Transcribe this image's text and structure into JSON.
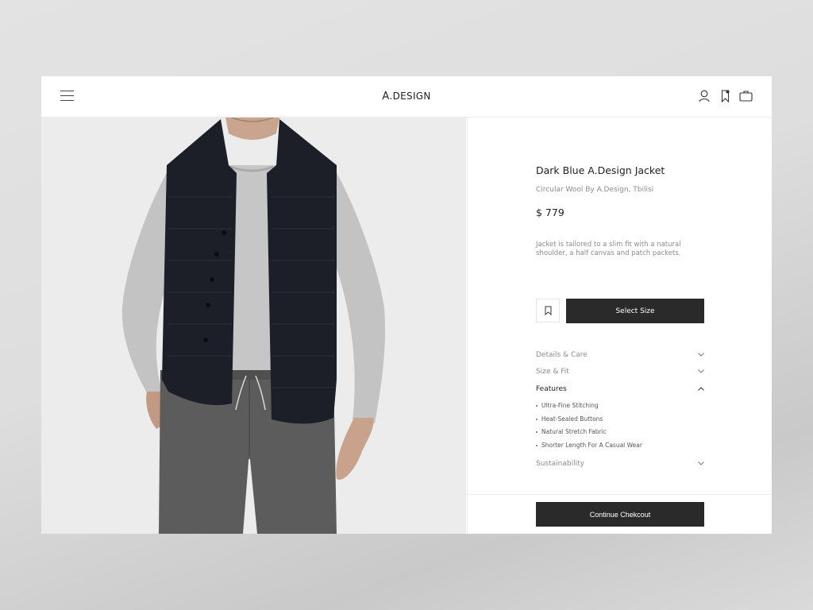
{
  "header": {
    "logo_mark": "A",
    "logo_text": ".DESIGN"
  },
  "product": {
    "title": "Dark Blue A.Design Jacket",
    "subtitle": "Circular Wool By A.Design, Tbilisi",
    "price": "$ 779",
    "description": "Jacket is tailored to a slim fit with a natural shoulder, a half canvas and patch packets.",
    "select_size_label": "Select Size"
  },
  "accordion": {
    "details": "Details & Care",
    "size_fit": "Size & Fit",
    "features": "Features",
    "sustainability": "Sustainability"
  },
  "features": [
    "Ultra-Fine Stitching",
    "Heat-Sealed Buttons",
    "Natural Stretch Fabric",
    "Shorter Length For A Casual Wear"
  ],
  "checkout": {
    "label": "Continue Chekcout"
  },
  "icons": {
    "menu": "menu-icon",
    "account": "user-icon",
    "wishlist": "bookmark-icon",
    "bag": "bag-icon",
    "chevron_down": "chevron-down-icon",
    "chevron_up": "chevron-up-icon"
  },
  "colors": {
    "button_bg": "#2a2a2a",
    "vest": "#1b1e26",
    "sweater": "#c4c4c4",
    "trousers": "#5a5a5a"
  }
}
